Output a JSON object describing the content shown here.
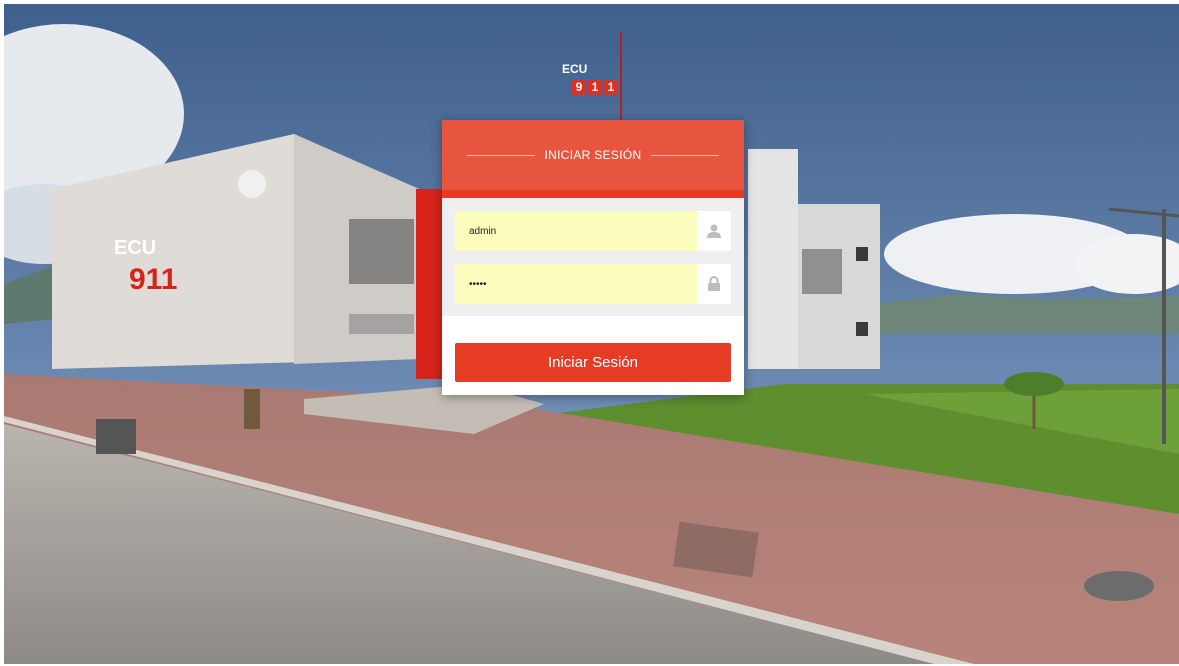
{
  "login": {
    "title": "INICIAR SESIÓN",
    "username_value": "admin",
    "password_value": "•••••",
    "submit_label": "Iniciar Sesión",
    "user_icon": "user-icon",
    "lock_icon": "lock-icon"
  },
  "background": {
    "logo_text": "ECU",
    "logo_digits": [
      "9",
      "1",
      "1"
    ]
  },
  "colors": {
    "header": "#e8553e",
    "header_bar": "#e63a22",
    "button": "#e63b25",
    "input_bg": "#fbfdbd"
  }
}
